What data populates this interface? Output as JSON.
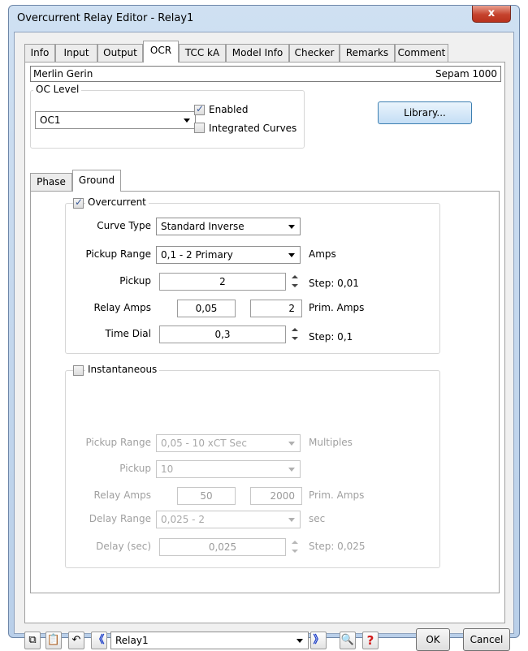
{
  "window": {
    "title": "Overcurrent Relay Editor - Relay1",
    "close_glyph": "x"
  },
  "tabs": [
    "Info",
    "Input",
    "Output",
    "OCR",
    "TCC kA",
    "Model Info",
    "Checker",
    "Remarks",
    "Comment"
  ],
  "active_tab": "OCR",
  "header": {
    "manufacturer": "Merlin Gerin",
    "model": "Sepam 1000"
  },
  "oc_level": {
    "label": "OC Level",
    "value": "OC1",
    "enabled_label": "Enabled",
    "enabled": true,
    "integrated_label": "Integrated Curves",
    "integrated": false
  },
  "library_button": "Library...",
  "subtabs": [
    "Phase",
    "Ground"
  ],
  "active_subtab": "Ground",
  "overcurrent": {
    "label": "Overcurrent",
    "checked": true,
    "curve_type_label": "Curve Type",
    "curve_type": "Standard Inverse",
    "pickup_range_label": "Pickup Range",
    "pickup_range": "0,1 - 2  Primary",
    "pickup_range_unit": "Amps",
    "pickup_label": "Pickup",
    "pickup": "2",
    "pickup_step": "Step: 0,01",
    "relay_amps_label": "Relay Amps",
    "relay_amps": "0,05",
    "prim_amps": "2",
    "prim_amps_label": "Prim. Amps",
    "time_dial_label": "Time Dial",
    "time_dial": "0,3",
    "time_dial_step": "Step: 0,1"
  },
  "instantaneous": {
    "label": "Instantaneous",
    "checked": false,
    "pickup_range_label": "Pickup Range",
    "pickup_range": "0,05 - 10  xCT Sec",
    "pickup_range_unit": "Multiples",
    "pickup_label": "Pickup",
    "pickup": "10",
    "relay_amps_label": "Relay Amps",
    "relay_amps": "50",
    "prim_amps": "2000",
    "prim_amps_label": "Prim. Amps",
    "delay_range_label": "Delay Range",
    "delay_range": "0,025 - 2",
    "delay_range_unit": "sec",
    "delay_label": "Delay (sec)",
    "delay": "0,025",
    "delay_step": "Step: 0,025"
  },
  "footer": {
    "relay_select": "Relay1",
    "ok_label": "OK",
    "cancel_label": "Cancel",
    "help_glyph": "?",
    "prev_glyph": "《",
    "next_glyph": "》"
  },
  "colors": {
    "accent": "#3c7fb1",
    "close": "#c5422d",
    "nav_arrow": "#1a3cc8",
    "help": "#d11a1a"
  }
}
